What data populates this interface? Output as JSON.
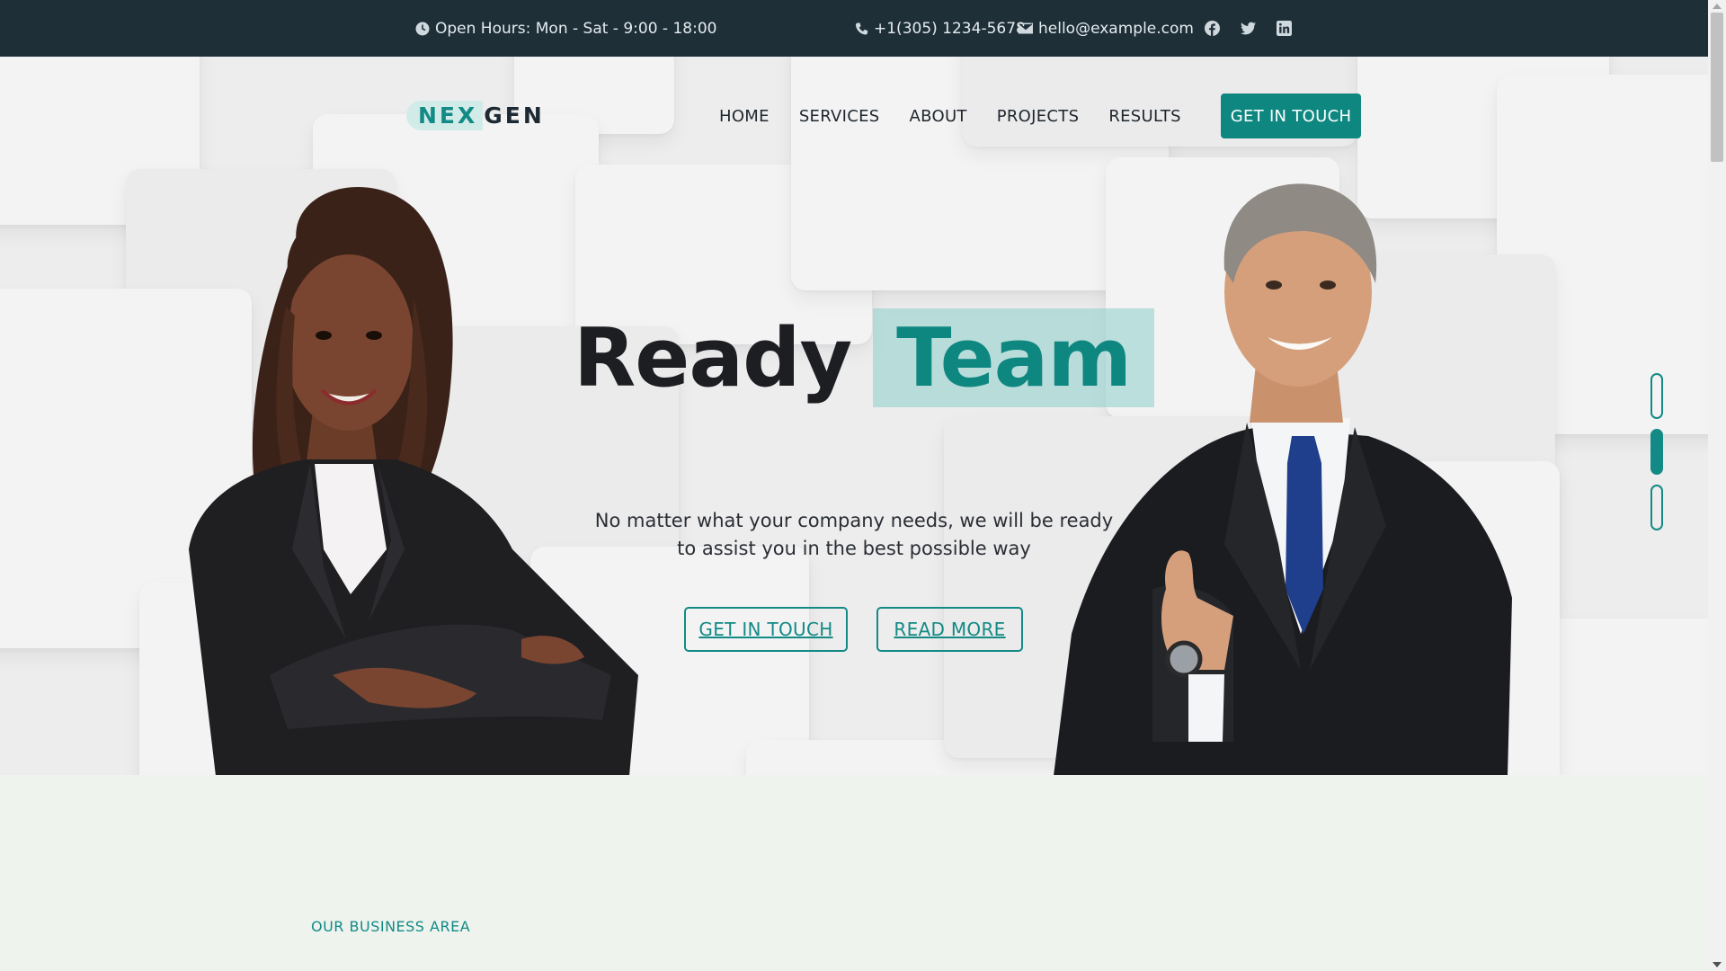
{
  "topbar": {
    "hours": "Open Hours: Mon - Sat - 9:00 - 18:00",
    "phone": "+1(305) 1234-5678",
    "email": "hello@example.com",
    "social_icons": [
      "facebook-icon",
      "twitter-icon",
      "linkedin-icon"
    ]
  },
  "logo": {
    "part1": "NEX",
    "part2": "GEN"
  },
  "nav": {
    "items": [
      "HOME",
      "SERVICES",
      "ABOUT",
      "PROJECTS",
      "RESULTS"
    ],
    "cta": "GET IN TOUCH"
  },
  "hero": {
    "headline_word1": "Ready",
    "headline_word2": "Team",
    "subtitle_line1": "No matter what your company needs, we will be ready",
    "subtitle_line2": "to assist you in the best possible way",
    "button_primary": "GET IN TOUCH",
    "button_secondary": "READ MORE",
    "slides": 3,
    "active_slide": 2
  },
  "section": {
    "eyebrow": "OUR BUSINESS AREA"
  },
  "colors": {
    "accent": "#0f8781",
    "topbar_bg": "#1f2f38",
    "section_bg": "#eef3ee"
  }
}
